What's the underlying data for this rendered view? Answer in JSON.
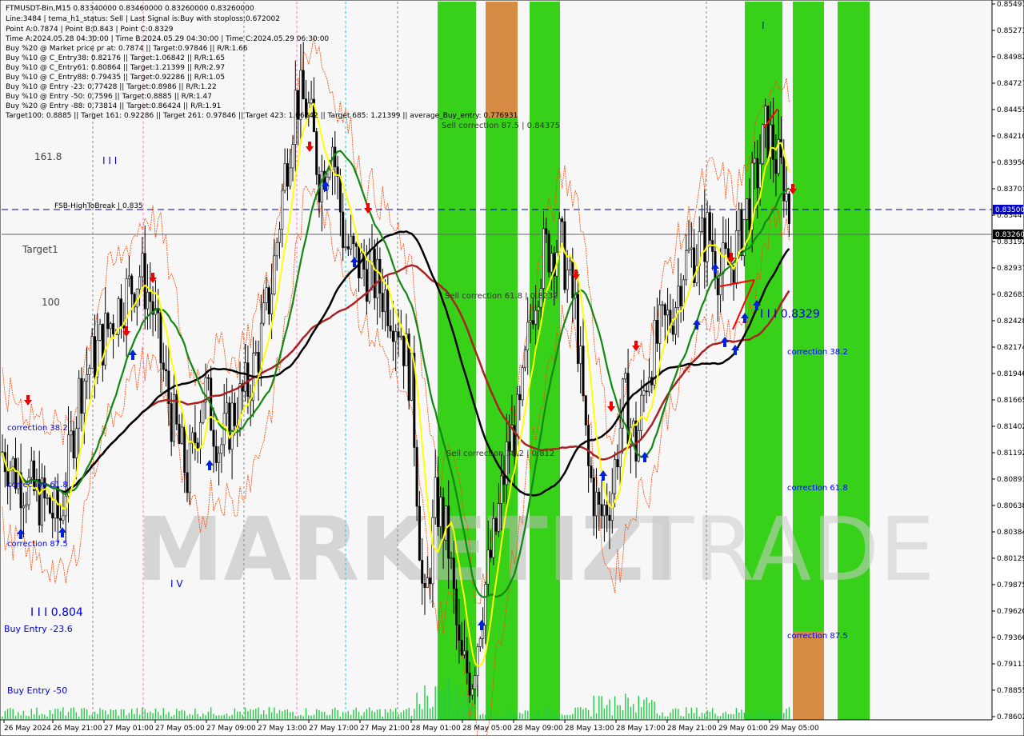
{
  "header": {
    "lines": [
      "FTMUSDT-Bin,M15  0.83340000 0.83460000 0.83260000 0.83260000",
      "Line:3484 | tema_h1_status: Sell | Last Signal is:Buy with stoploss:0.672002",
      "Point A:0.7874 | Point B:0.843 | Point C:0.8329",
      "Time A:2024.05.28 04:30:00 | Time B:2024.05.29 04:30:00 | Time C:2024.05.29 06:30:00",
      "Buy %20 @ Market price pr at: 0.7874 || Target:0.97846 || R/R:1.66",
      "Buy %10 @ C_Entry38: 0.82176 || Target:1.06842 || R/R:1.65",
      "Buy %10 @ C_Entry61: 0.80864 || Target:1.21399 || R/R:2.97",
      "Buy %10 @ C_Entry88: 0.79435 || Target:0.92286 || R/R:1.05",
      "Buy %10 @ Entry -23: 0.77428 || Target:0.8986 || R/R:1.22",
      "Buy %10 @ Entry -50: 0.7596 || Target:0.8885 || R/R:1.47",
      "Buy %20 @ Entry -88: 0.73814 || Target:0.86424 || R/R:1.91",
      "Target100: 0.8885 || Target 161: 0.92286 || Target 261: 0.97846 || Target 423: 1.06842 || Target 685: 1.21399 || average_Buy_entry: 0.776931"
    ]
  },
  "watermark": {
    "text_gray": "MARKETIZI",
    "text_light": "TRADE"
  },
  "chart_data": {
    "type": "candlestick",
    "symbol": "FTMUSDT-Bin",
    "timeframe": "M15",
    "ylim": [
      0.786,
      0.855
    ],
    "y_ticks": [
      "0.85491",
      "0.85273",
      "0.84982",
      "0.84727",
      "0.84455",
      "0.84210",
      "0.83950",
      "0.83701",
      "0.83447",
      "0.83192",
      "0.82937",
      "0.82683",
      "0.82428",
      "0.82174",
      "0.81946",
      "0.81665",
      "0.81402",
      "0.81192",
      "0.80893",
      "0.80638",
      "0.80384",
      "0.80129",
      "0.79875",
      "0.79620",
      "0.79366",
      "0.79111",
      "0.78855",
      "0.78602"
    ],
    "x_ticks": [
      "26 May 2024",
      "26 May 21:00",
      "27 May 01:00",
      "27 May 05:00",
      "27 May 09:00",
      "27 May 13:00",
      "27 May 17:00",
      "27 May 21:00",
      "28 May 01:00",
      "28 May 05:00",
      "28 May 09:00",
      "28 May 13:00",
      "28 May 17:00",
      "28 May 21:00",
      "29 May 01:00",
      "29 May 05:00"
    ],
    "price_labels": [
      {
        "label": "0.83500",
        "value": 0.835,
        "color": "#0000cc"
      },
      {
        "label": "0.83260",
        "value": 0.8326,
        "color": "#000000"
      }
    ],
    "horizontal_lines": [
      {
        "label": "FSB-HighToBreak | 0.835",
        "value": 0.835,
        "style": "dashed",
        "color": "#0000aa"
      },
      {
        "label": "",
        "value": 0.8326,
        "style": "solid",
        "color": "#555555"
      }
    ],
    "zones": [
      {
        "color": "#22cc00",
        "label": "Sell correction 87.5 | 0.84375"
      },
      {
        "color": "#22cc00",
        "label": "Sell correction 61.8 | 0.8232"
      },
      {
        "color": "#22cc00",
        "label": "Sell correction 38.2 | 0.812"
      },
      {
        "color": "#dd8844",
        "label": ""
      }
    ],
    "annotations": [
      {
        "text": "161.8"
      },
      {
        "text": "Target1"
      },
      {
        "text": "100"
      },
      {
        "text": "I I I"
      },
      {
        "text": "I V"
      },
      {
        "text": "I I I 0.804"
      },
      {
        "text": "I I I 0.8329"
      },
      {
        "text": "I"
      },
      {
        "text": "correction 38.2"
      },
      {
        "text": "correction 61.8"
      },
      {
        "text": "correction 87.5"
      },
      {
        "text": "Buy Entry -23.6"
      },
      {
        "text": "Buy Entry -50"
      }
    ],
    "series": [
      {
        "name": "",
        "color": "#ffff00"
      },
      {
        "name": "",
        "color": "#118811"
      },
      {
        "name": "",
        "color": "#000000"
      },
      {
        "name": "",
        "color": "#aa2222"
      },
      {
        "name": "",
        "color": "#ff4400"
      }
    ],
    "price_path": [
      [
        0,
        0.812
      ],
      [
        25,
        0.809
      ],
      [
        50,
        0.807
      ],
      [
        75,
        0.805
      ],
      [
        100,
        0.818
      ],
      [
        125,
        0.822
      ],
      [
        150,
        0.826
      ],
      [
        175,
        0.829
      ],
      [
        190,
        0.826
      ],
      [
        200,
        0.821
      ],
      [
        215,
        0.815
      ],
      [
        235,
        0.809
      ],
      [
        255,
        0.818
      ],
      [
        275,
        0.812
      ],
      [
        290,
        0.815
      ],
      [
        310,
        0.818
      ],
      [
        325,
        0.822
      ],
      [
        340,
        0.828
      ],
      [
        355,
        0.838
      ],
      [
        370,
        0.846
      ],
      [
        385,
        0.845
      ],
      [
        400,
        0.838
      ],
      [
        415,
        0.842
      ],
      [
        430,
        0.832
      ],
      [
        445,
        0.83
      ],
      [
        460,
        0.829
      ],
      [
        480,
        0.827
      ],
      [
        500,
        0.824
      ],
      [
        515,
        0.818
      ],
      [
        530,
        0.795
      ],
      [
        545,
        0.807
      ],
      [
        560,
        0.803
      ],
      [
        575,
        0.791
      ],
      [
        590,
        0.79
      ],
      [
        605,
        0.798
      ],
      [
        620,
        0.804
      ],
      [
        635,
        0.812
      ],
      [
        650,
        0.815
      ],
      [
        665,
        0.826
      ],
      [
        680,
        0.831
      ],
      [
        700,
        0.832
      ],
      [
        720,
        0.825
      ],
      [
        735,
        0.81
      ],
      [
        750,
        0.805
      ],
      [
        765,
        0.808
      ],
      [
        780,
        0.817
      ],
      [
        795,
        0.812
      ],
      [
        810,
        0.82
      ],
      [
        825,
        0.823
      ],
      [
        840,
        0.825
      ],
      [
        855,
        0.83
      ],
      [
        870,
        0.831
      ],
      [
        885,
        0.833
      ],
      [
        900,
        0.829
      ],
      [
        915,
        0.83
      ],
      [
        930,
        0.834
      ],
      [
        945,
        0.838
      ],
      [
        958,
        0.843
      ],
      [
        970,
        0.84
      ],
      [
        980,
        0.838
      ],
      [
        990,
        0.8326
      ]
    ],
    "volume": "present"
  }
}
